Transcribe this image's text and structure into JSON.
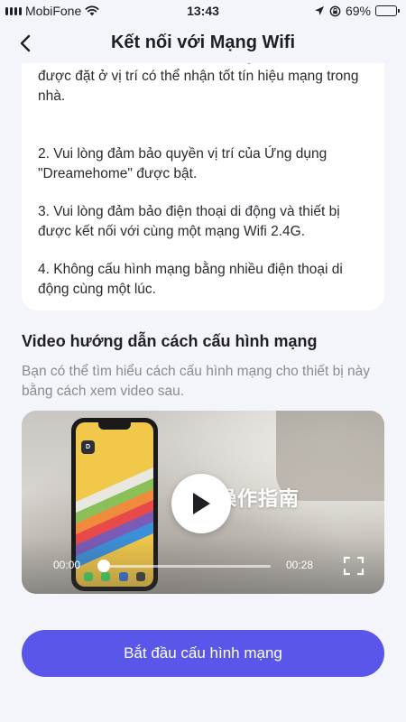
{
  "status_bar": {
    "carrier": "MobiFone",
    "time": "13:43",
    "battery": "69%",
    "battery_level": 0.69
  },
  "header": {
    "title": "Kết nối với Mạng Wifi"
  },
  "tips": [
    "thời đảm bảo cả điện thoại di động và thiết bị đều được đặt ở vị trí có thể nhận tốt tín hiệu mạng trong nhà.",
    "2. Vui lòng đảm bảo quyền vị trí của Ứng dụng \"Dreamehome\" được bật.",
    "3. Vui lòng đảm bảo điện thoại di động và thiết bị được kết nối với cùng một mạng Wifi 2.4G.",
    "4. Không cấu hình mạng bằng nhiều điện thoại di động cùng một lúc."
  ],
  "video_section": {
    "title": "Video hướng dẫn cách cấu hình mạng",
    "description": "Bạn có thể tìm hiểu cách cấu hình mạng cho thiết bị này bằng cách xem video sau.",
    "overlay_text": "网操作指南",
    "current_time": "00:00",
    "duration": "00:28",
    "progress": 0.0
  },
  "cta": {
    "label": "Bắt đầu cấu hình mạng"
  },
  "colors": {
    "accent": "#5b56ea",
    "background": "#f4f5fb"
  },
  "icons": {
    "back": "chevron-left-icon",
    "wifi": "wifi-icon",
    "location": "location-arrow-icon",
    "play": "play-icon",
    "fullscreen": "fullscreen-icon"
  }
}
